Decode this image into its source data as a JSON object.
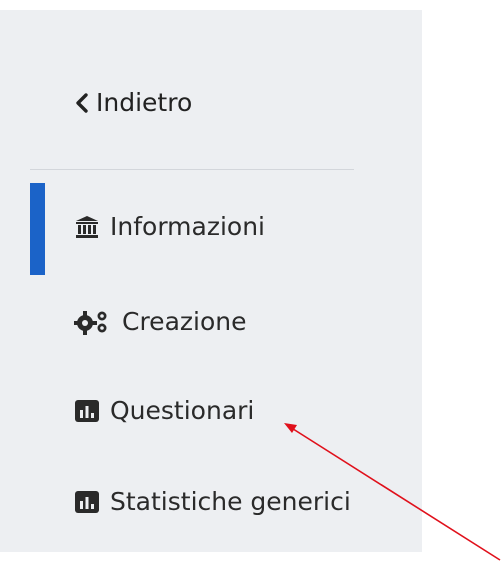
{
  "back": {
    "label": "Indietro",
    "icon": "chevron-left-icon"
  },
  "nav": {
    "items": [
      {
        "label": "Informazioni",
        "icon": "institution-icon",
        "active": true
      },
      {
        "label": "Creazione",
        "icon": "gears-icon",
        "active": false
      },
      {
        "label": "Questionari",
        "icon": "bar-chart-icon",
        "active": false
      },
      {
        "label": "Statistiche generici",
        "icon": "bar-chart-icon",
        "active": false
      }
    ]
  },
  "colors": {
    "active_accent": "#1b63c8",
    "sidebar_bg": "#edeff2",
    "annotation_arrow": "#e0101b"
  }
}
